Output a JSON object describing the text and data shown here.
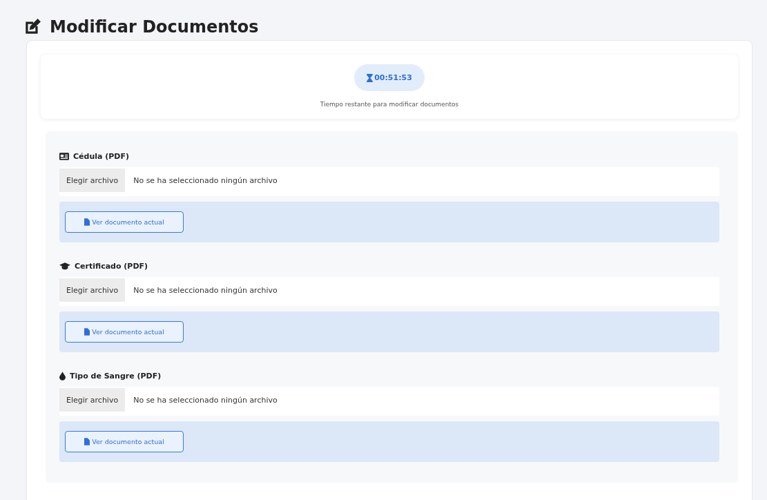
{
  "page": {
    "title": "Modificar Documentos"
  },
  "timer": {
    "time": "00:51:53",
    "caption": "Tiempo restante para modificar documentos"
  },
  "documents": [
    {
      "kind": "id-card",
      "label": "Cédula (PDF)",
      "choose_button": "Elegir archivo",
      "file_status": "No se ha seleccionado ningún archivo",
      "view_button": "Ver documento actual"
    },
    {
      "kind": "graduation-cap",
      "label": "Certificado (PDF)",
      "choose_button": "Elegir archivo",
      "file_status": "No se ha seleccionado ningún archivo",
      "view_button": "Ver documento actual"
    },
    {
      "kind": "drop",
      "label": "Tipo de Sangre (PDF)",
      "choose_button": "Elegir archivo",
      "file_status": "No se ha seleccionado ningún archivo",
      "view_button": "Ver documento actual"
    }
  ]
}
